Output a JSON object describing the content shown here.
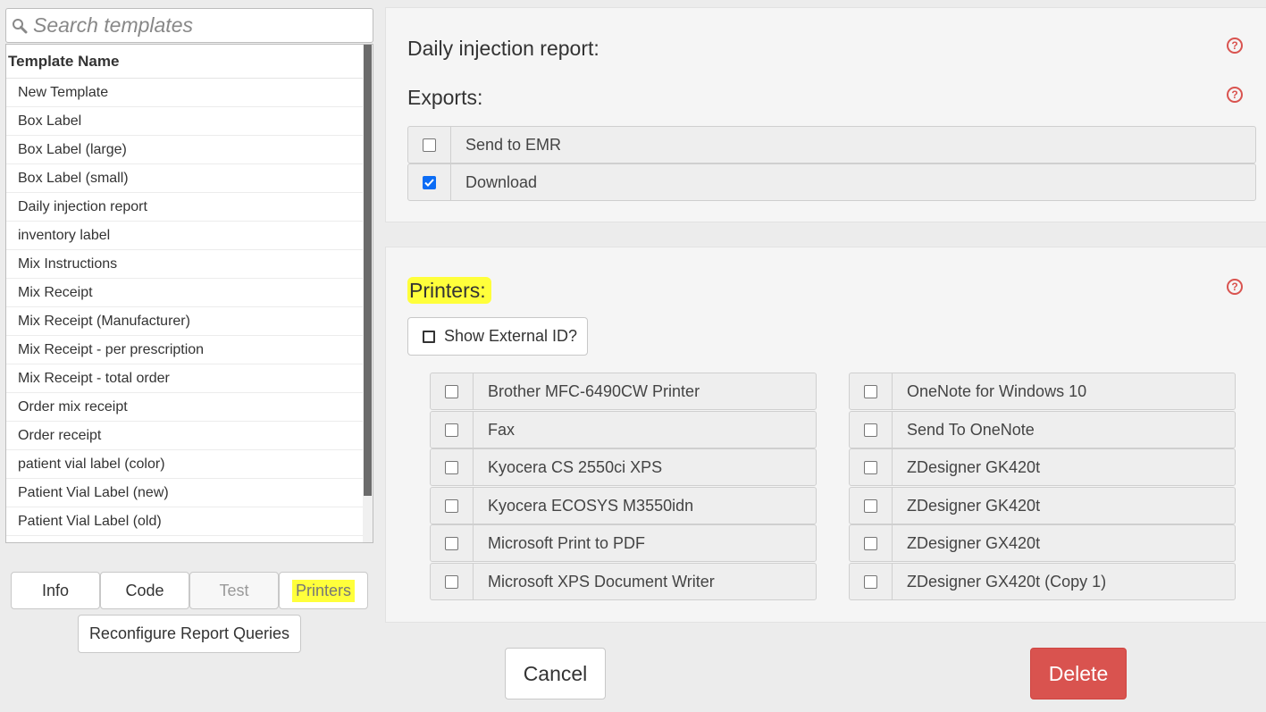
{
  "search": {
    "placeholder": "Search templates"
  },
  "template_list": {
    "header": "Template Name",
    "items": [
      "New Template",
      "Box Label",
      "Box Label (large)",
      "Box Label (small)",
      "Daily injection report",
      "inventory label",
      "Mix Instructions",
      "Mix Receipt",
      "Mix Receipt (Manufacturer)",
      "Mix Receipt - per prescription",
      "Mix Receipt - total order",
      "Order mix receipt",
      "Order receipt",
      "patient vial label (color)",
      "Patient Vial Label (new)",
      "Patient Vial Label (old)"
    ]
  },
  "tabs": {
    "info": "Info",
    "code": "Code",
    "test": "Test",
    "printers": "Printers"
  },
  "reconfigure_label": "Reconfigure Report Queries",
  "report": {
    "title": "Daily injection report:",
    "exports_title": "Exports:",
    "exports": [
      {
        "label": "Send to EMR",
        "checked": false
      },
      {
        "label": "Download",
        "checked": true
      }
    ]
  },
  "printers": {
    "title": "Printers:",
    "show_external_id": "Show External ID?",
    "left": [
      "Brother MFC-6490CW Printer",
      "Fax",
      "Kyocera CS 2550ci XPS",
      "Kyocera ECOSYS M3550idn",
      "Microsoft Print to PDF",
      "Microsoft XPS Document Writer"
    ],
    "right": [
      "OneNote for Windows 10",
      "Send To OneNote",
      "ZDesigner GK420t",
      "ZDesigner GK420t",
      "ZDesigner GX420t",
      "ZDesigner GX420t (Copy 1)"
    ]
  },
  "actions": {
    "cancel": "Cancel",
    "delete": "Delete"
  },
  "colors": {
    "danger": "#d9534f",
    "highlight": "#ffff3b",
    "check": "#0b6cf5"
  }
}
